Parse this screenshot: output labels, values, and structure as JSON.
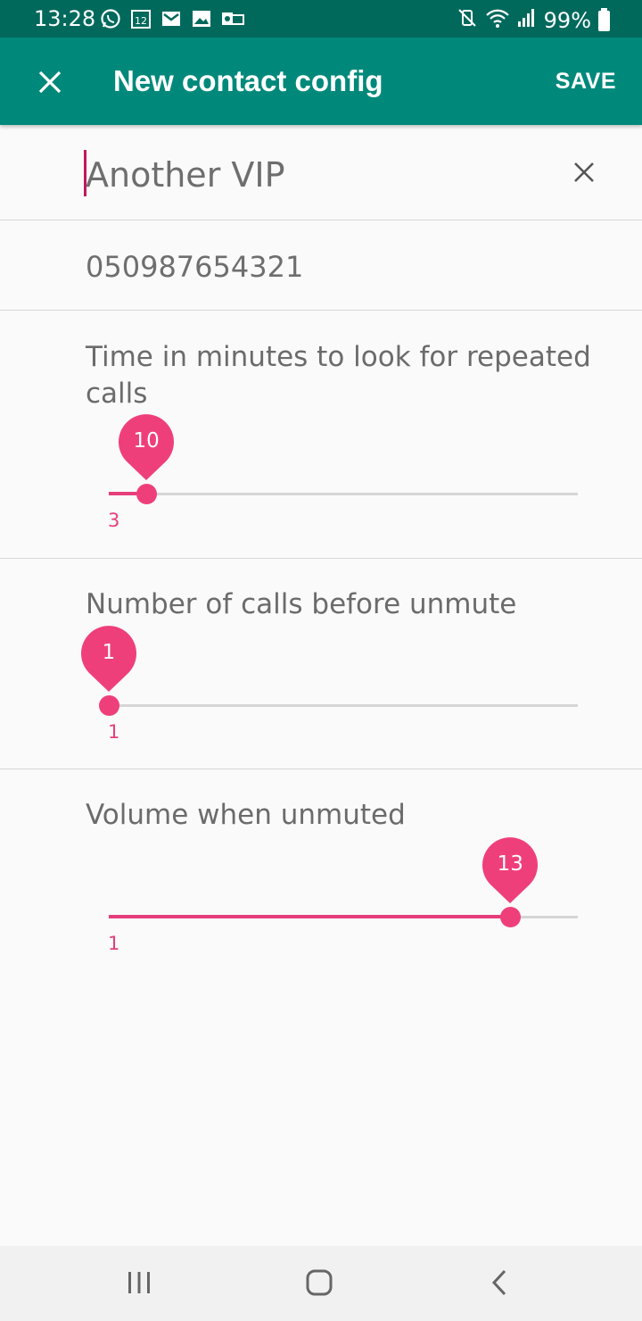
{
  "status_bar": {
    "time": "13:28",
    "battery_percent": "99%",
    "notification_icons": [
      "whatsapp-icon",
      "calendar-icon",
      "gmail-icon",
      "gallery-icon",
      "outlook-icon"
    ],
    "system_icons": [
      "mute-vibrate-icon",
      "wifi-icon",
      "signal-icon",
      "battery-icon"
    ]
  },
  "app_bar": {
    "title": "New contact config",
    "save_label": "SAVE",
    "background_color": "#00897b"
  },
  "form": {
    "name_value": "Another VIP",
    "phone_value": "050987654321",
    "time_label": "Time in minutes to look for repeated calls",
    "time_value": "10",
    "time_min": "3",
    "time_fraction": 0.08,
    "calls_label": "Number of calls before unmute",
    "calls_value": "1",
    "calls_min": "1",
    "calls_fraction": 0,
    "volume_label": "Volume when unmuted",
    "volume_value": "13",
    "volume_min": "1",
    "volume_fraction": 0.856,
    "accent_color": "#e63e7a"
  },
  "nav_bar": {
    "buttons": [
      "recent-apps-icon",
      "home-icon",
      "back-icon"
    ]
  }
}
